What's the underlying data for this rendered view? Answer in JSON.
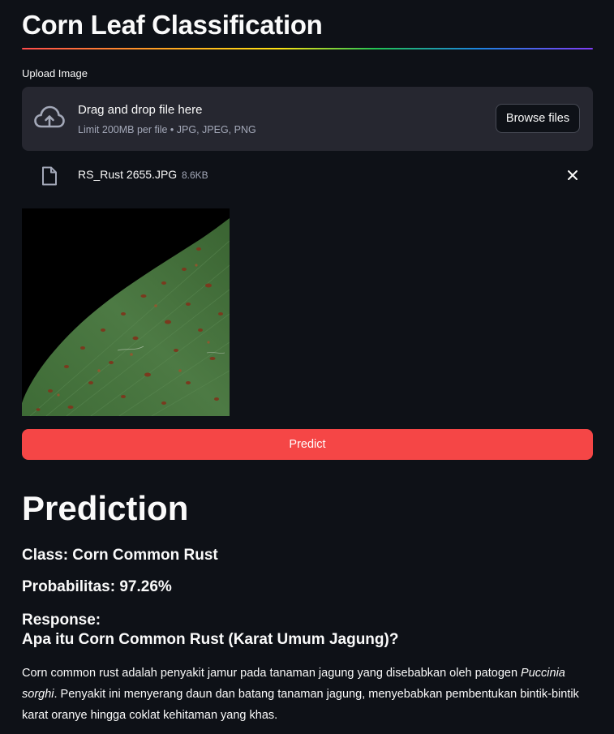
{
  "app": {
    "title": "Corn Leaf Classification"
  },
  "uploader": {
    "label": "Upload Image",
    "dropzone_text": "Drag and drop file here",
    "limit_text": "Limit 200MB per file • JPG, JPEG, PNG",
    "browse_label": "Browse files",
    "icon": "cloud-upload-icon"
  },
  "uploaded_file": {
    "name": "RS_Rust 2655.JPG",
    "size": "8.6KB",
    "icon": "file-icon"
  },
  "predict_button": {
    "label": "Predict"
  },
  "prediction": {
    "heading": "Prediction",
    "class_line": "Class: Corn Common Rust",
    "probability_line": "Probabilitas: 97.26%",
    "response_label": "Response:",
    "question": "Apa itu Corn Common Rust (Karat Umum Jagung)?",
    "paragraph_part1": "Corn common rust adalah penyakit jamur pada tanaman jagung yang disebabkan oleh patogen ",
    "paragraph_italic": "Puccinia sorghi",
    "paragraph_part2": ". Penyakit ini menyerang daun dan batang tanaman jagung, menyebabkan pembentukan bintik-bintik karat oranye hingga coklat kehitaman yang khas."
  },
  "colors": {
    "background": "#0e1117",
    "dropzone_bg": "#262730",
    "primary_button": "#f54646",
    "muted_text": "#a3a8b8"
  }
}
